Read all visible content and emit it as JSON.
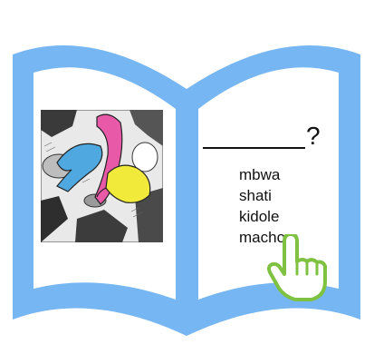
{
  "question": {
    "mark": "?"
  },
  "options": [
    "mbwa",
    "shati",
    "kidole",
    "macho"
  ],
  "icons": {
    "book": "open-book-icon",
    "pointer": "pointing-hand-icon",
    "illustration": "picture-illustration"
  },
  "colors": {
    "book_blue": "#76b6f2",
    "hand_green": "#7fc140",
    "picture_pink": "#e85aa8",
    "picture_blue": "#4fa8e0",
    "picture_yellow": "#f1ea3a"
  }
}
